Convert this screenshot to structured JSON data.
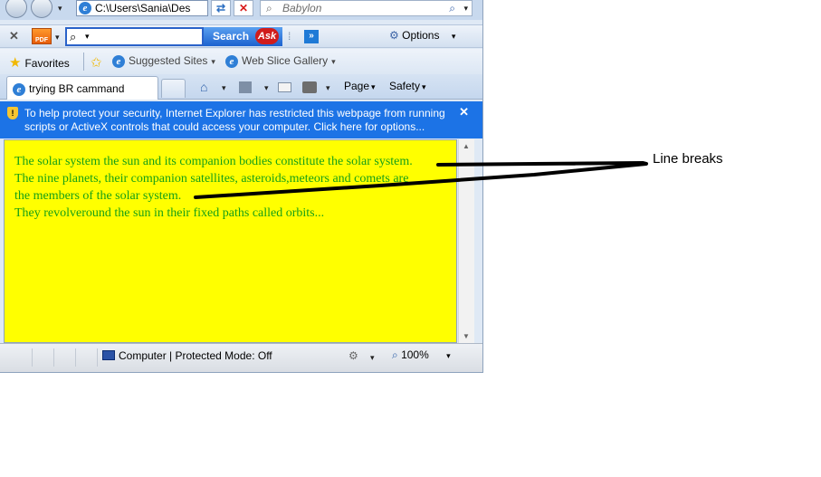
{
  "address_bar": {
    "url": "C:\\Users\\Sania\\Des",
    "search_placeholder": "Babylon"
  },
  "ask_toolbar": {
    "search_button": "Search",
    "brand": "Ask",
    "options_label": "Options"
  },
  "favorites_bar": {
    "favorites": "Favorites",
    "suggested_sites": "Suggested Sites",
    "web_slice_gallery": "Web Slice Gallery"
  },
  "tab": {
    "title": "trying BR cammand"
  },
  "command_bar": {
    "page": "Page",
    "safety": "Safety"
  },
  "info_bar": {
    "message": "To help protect your security, Internet Explorer has restricted this webpage from running scripts or ActiveX controls that could access your computer. Click here for options..."
  },
  "page": {
    "lines": [
      "The solar system the sun and its companion bodies constitute the solar system.",
      "The nine planets, their companion satellites, asteroids,meteors and comets are",
      "the members of the solar system.",
      "They revolveround the sun in their fixed paths called orbits..."
    ],
    "background_color": "#ffff00",
    "text_color": "#16a016"
  },
  "status_bar": {
    "zone": "Computer | Protected Mode: Off",
    "zoom": "100%"
  },
  "annotation": {
    "label": "Line breaks"
  }
}
